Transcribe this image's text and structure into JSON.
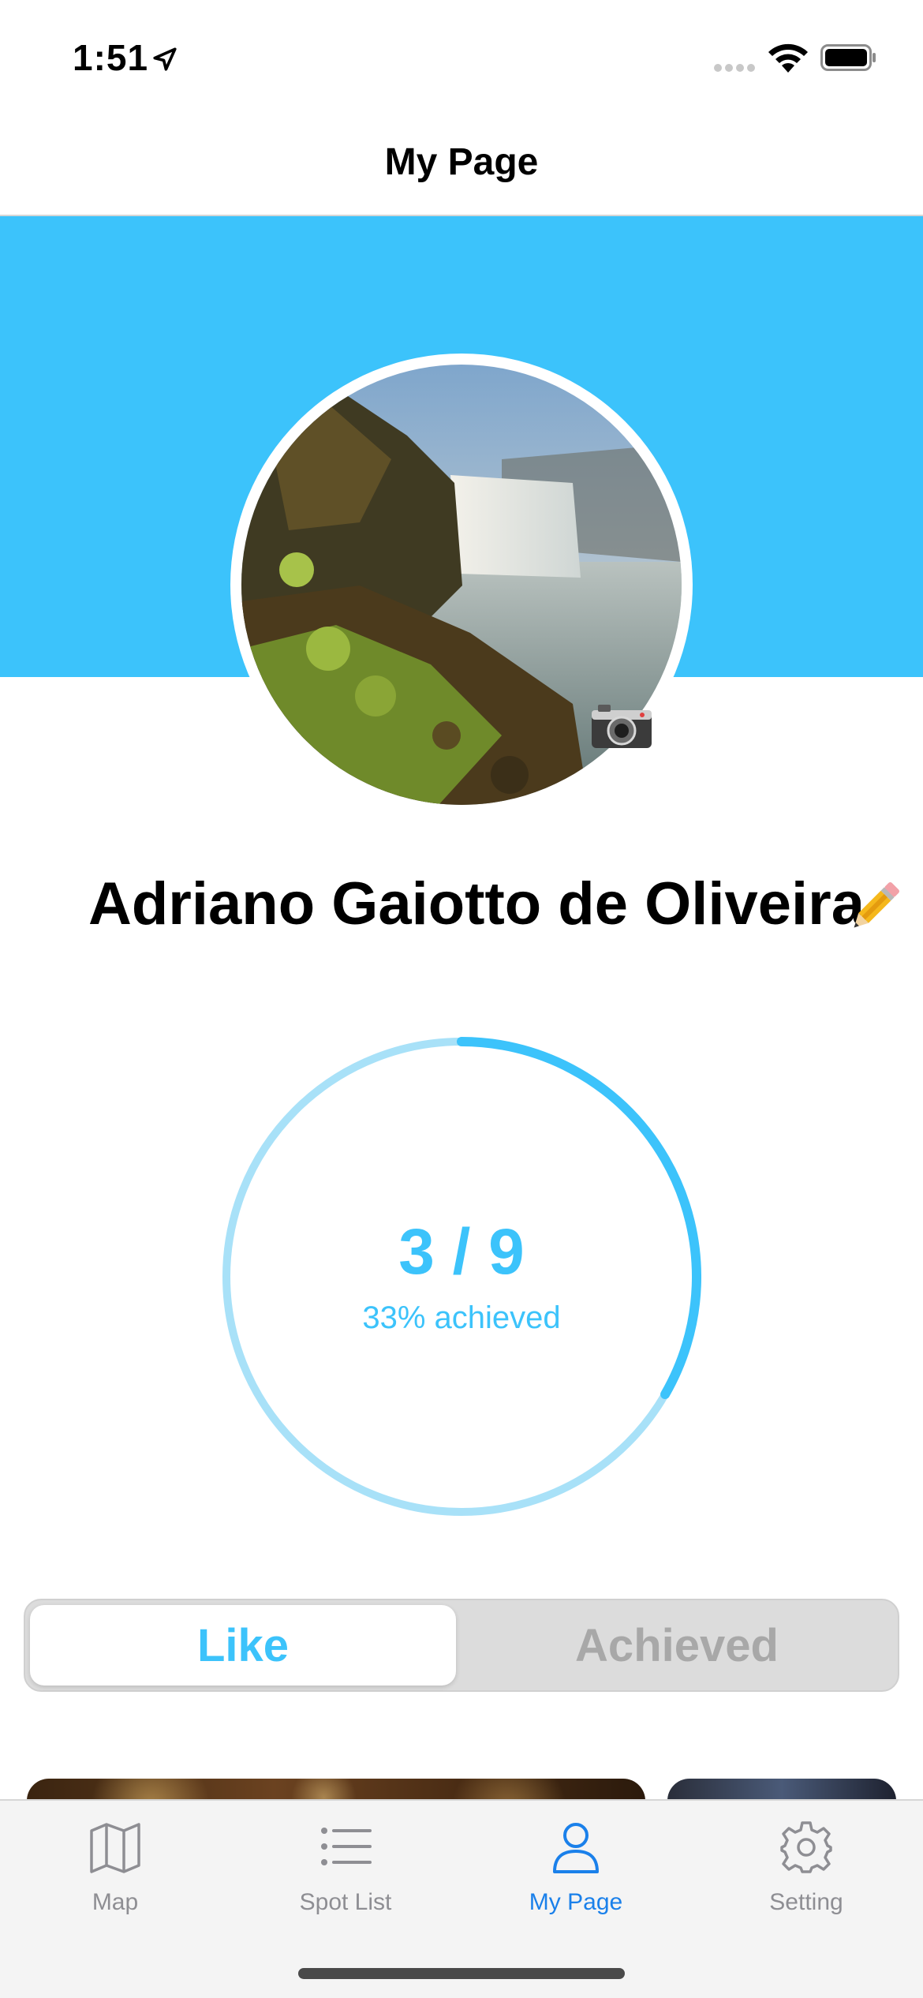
{
  "status_bar": {
    "time": "1:51",
    "icons": [
      "location-arrow-icon",
      "signal-icon",
      "wifi-icon",
      "battery-icon"
    ]
  },
  "nav": {
    "title": "My Page"
  },
  "colors": {
    "accent": "#3cc3fb",
    "accent_light": "#a8e1f8",
    "tab_active": "#1a80ea",
    "tab_inactive": "#8e8e93",
    "segment_inactive_text": "#a8a8a8"
  },
  "profile": {
    "name": "Adriano Gaiotto de Oliveira",
    "avatar_icon": "waterfall-photo",
    "camera_icon": "camera-icon",
    "edit_icon": "pencil-icon"
  },
  "progress": {
    "count": "3 / 9",
    "achieved": 3,
    "total": 9,
    "label": "33% achieved"
  },
  "segments": {
    "like": "Like",
    "achieved": "Achieved",
    "selected": "like"
  },
  "tabs": [
    {
      "label": "Map",
      "icon": "map-icon",
      "active": false
    },
    {
      "label": "Spot List",
      "icon": "list-icon",
      "active": false
    },
    {
      "label": "My Page",
      "icon": "person-icon",
      "active": true
    },
    {
      "label": "Setting",
      "icon": "gear-icon",
      "active": false
    }
  ]
}
